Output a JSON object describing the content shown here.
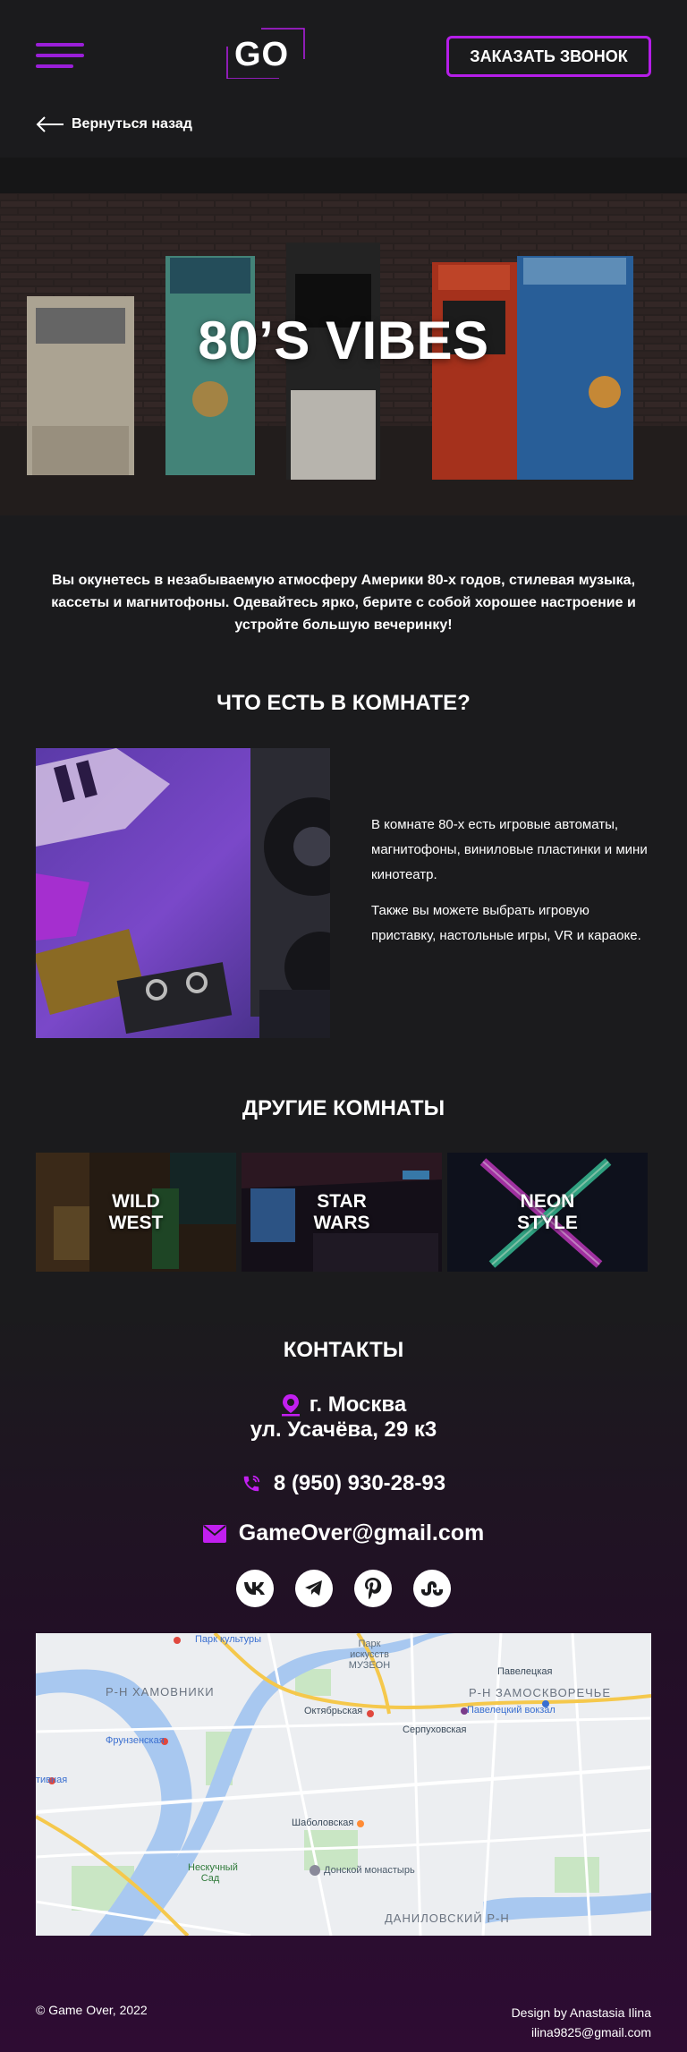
{
  "header": {
    "logo_text": "GO",
    "call_button": "ЗАКАЗАТЬ ЗВОНОК",
    "back_link": "Вернуться назад"
  },
  "hero": {
    "title": "80’S VIBES"
  },
  "intro": "Вы окунетесь в незабываемую атмосферу Америки 80-х годов, стилевая музыка, кассеты и магнитофоны. Одевайтесь ярко, берите с собой хорошее настроение и устройте большую вечеринку!",
  "room": {
    "title": "ЧТО ЕСТЬ В КОМНАТЕ?",
    "paragraph_1": "В комнате 80-х есть игровые автоматы, магнитофоны, виниловые пластинки и мини кинотеатр.",
    "paragraph_2": "Также вы можете выбрать игровую приставку, настольные игры, VR и караоке."
  },
  "other_rooms": {
    "title": "ДРУГИЕ КОМНАТЫ",
    "items": [
      {
        "label": "WILD\nWEST"
      },
      {
        "label": "STAR\nWARS"
      },
      {
        "label": "NEON\nSTYLE"
      }
    ]
  },
  "contacts": {
    "title": "КОНТАКТЫ",
    "city": "г. Москва",
    "street": "ул. Усачёва, 29 к3",
    "phone": "8 (950) 930-28-93",
    "email": "GameOver@gmail.com",
    "socials": [
      "vk-icon",
      "telegram-icon",
      "pinterest-icon",
      "stumbleupon-icon"
    ]
  },
  "map": {
    "labels": {
      "park_kultury": "Парк культуры",
      "park_iskusstv": "Парк искусств МУЗЕОН",
      "khamovniki": "Р-Н ХАМОВНИКИ",
      "paveletskaya": "Павелецкая",
      "zamoskvorechye": "Р-Н ЗАМОСКВОРЕЧЬЕ",
      "oktyabrskaya": "Октябрьская",
      "paveletsky_vokzal": "Павелецкий вокзал",
      "frunzenskaya": "Фрунзенская",
      "serpukhovskaya": "Серпуховская",
      "sportivnaya": "тивная",
      "shabolovskaya": "Шаболовская",
      "neskuchny": "Нескучный Сад",
      "donskoy": "Донской монастырь",
      "danilovsky": "ДАНИЛОВСКИЙ Р-Н"
    }
  },
  "footer": {
    "copyright": "© Game Over, 2022",
    "design": "Design by Anastasia Ilina",
    "designer_email": "ilina9825@gmail.com"
  },
  "colors": {
    "accent": "#b51ee8",
    "background": "#1b1b1d",
    "purple_icon": "#c21ff0"
  }
}
